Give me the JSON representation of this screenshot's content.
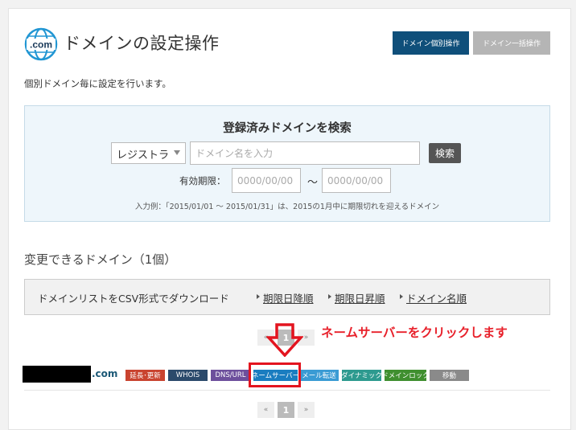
{
  "header": {
    "logo_text": ".com",
    "title": "ドメインの設定操作",
    "btn_single": "ドメイン個別操作",
    "btn_bulk": "ドメイン一括操作",
    "description": "個別ドメイン毎に設定を行います。"
  },
  "search": {
    "title": "登録済みドメインを検索",
    "select_value": "レジストラ",
    "name_placeholder": "ドメイン名を入力",
    "button": "検索",
    "expiry_label": "有効期限：",
    "date_from_placeholder": "0000/00/00",
    "tilde": "〜",
    "date_to_placeholder": "0000/00/00",
    "example": "入力例：「2015/01/01 〜 2015/01/31」は、2015の1月中に期限切れを迎えるドメイン"
  },
  "list": {
    "title": "変更できるドメイン（1個）",
    "csv_text": "ドメインリストをCSV形式でダウンロード",
    "sort_expiry_desc": "期限日降順",
    "sort_expiry_asc": "期限日昇順",
    "sort_domain_name": "ドメイン名順"
  },
  "pager": {
    "prev": "«",
    "current": "1",
    "next": "»"
  },
  "annotation": "ネームサーバーをクリックします",
  "domain_row": {
    "tld": ".com",
    "tags": [
      {
        "label": "延長･更新",
        "color": "#c9432f"
      },
      {
        "label": "WHOIS",
        "color": "#2b4a6b"
      },
      {
        "label": "DNS/URL",
        "color": "#6d4f9c"
      },
      {
        "label": "ネームサーバー",
        "color": "#1a7dc0"
      },
      {
        "label": "メール転送",
        "color": "#3a9bd4"
      },
      {
        "label": "ダイナミック",
        "color": "#2d9a8f"
      },
      {
        "label": "ドメインロック",
        "color": "#3f8f2f"
      },
      {
        "label": "移動",
        "color": "#8a8a8a"
      }
    ]
  },
  "colors": {
    "primary": "#0f4f7a",
    "highlight": "#e3141f",
    "panel": "#eef6fb"
  }
}
